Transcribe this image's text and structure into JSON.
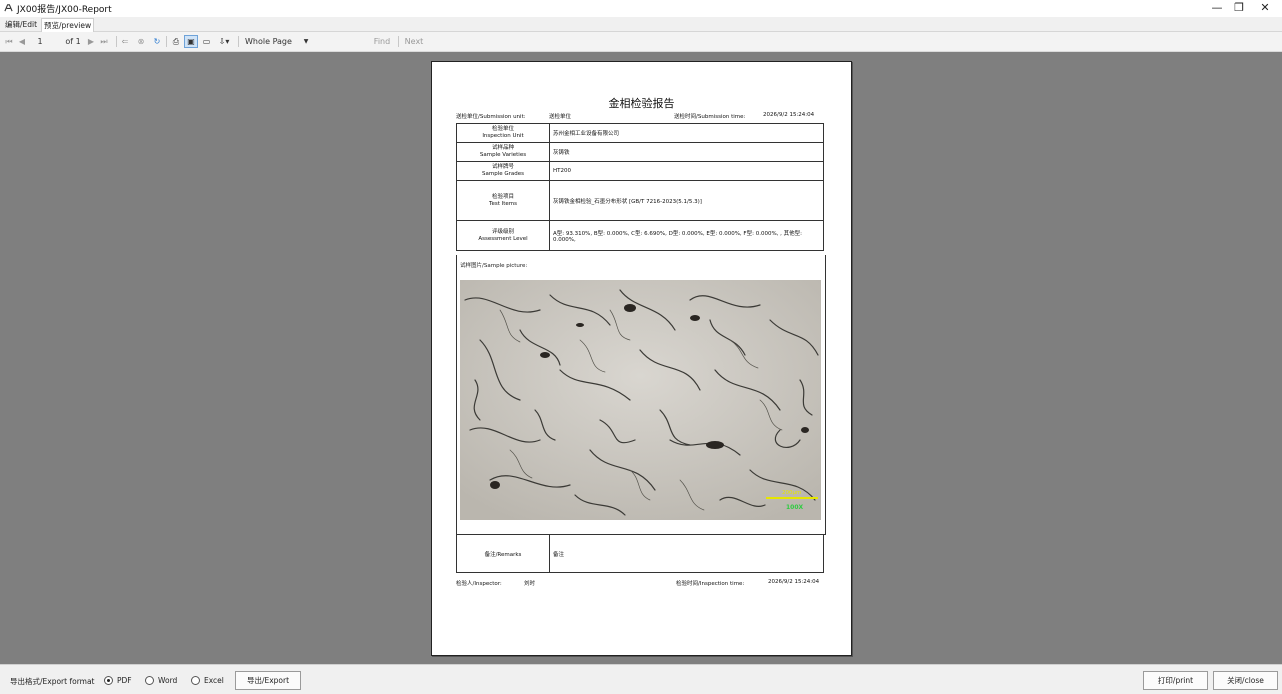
{
  "window": {
    "title": "JX00报告/JX00-Report",
    "minimize_glyph": "—",
    "restore_glyph": "❐",
    "close_glyph": "✕"
  },
  "tabs": [
    {
      "label": "编辑/Edit"
    },
    {
      "label": "预览/preview",
      "active": true
    }
  ],
  "toolbar": {
    "page_number": "1",
    "page_of": "of 1",
    "zoom_mode": "Whole Page",
    "search_value": "",
    "find_label": "Find",
    "next_label": "Next"
  },
  "report": {
    "title": "金相检验报告",
    "submission_unit_label": "送检单位/Submission unit:",
    "submission_unit_value": "送检单位",
    "submission_time_label": "送检时间/Submission time:",
    "submission_time_value": "2026/9/2 15:24:04",
    "rows": [
      {
        "label_cn": "检验单位",
        "label_en": "Inspection Unit",
        "value": "苏州金相工业设备有限公司"
      },
      {
        "label_cn": "试样品种",
        "label_en": "Sample Varieties",
        "value": "灰铸铁"
      },
      {
        "label_cn": "试样牌号",
        "label_en": "Sample Grades",
        "value": "HT200"
      },
      {
        "label_cn": "检验项目",
        "label_en": "Test Items",
        "value": "灰铸铁金相检验_石墨分布形状 [GB/T 7216-2023(5.1/5.3)]"
      },
      {
        "label_cn": "评级级别",
        "label_en": "Assessment Level",
        "value": "A型: 93.310%, B型: 0.000%, C型: 6.690%, D型: 0.000%, E型: 0.000%, F型: 0.000%, , 其他型: 0.000%,"
      }
    ],
    "sample_picture_label": "试样图片/Sample picture:",
    "scale_text": "200μm",
    "magnification_text": "100X",
    "remarks_label": "备注/Remarks",
    "remarks_value": "备注",
    "inspector_label": "检验人/Inspector:",
    "inspector_value": "刘时",
    "inspection_time_label": "检验时间/Inspection time:",
    "inspection_time_value": "2026/9/2 15:24:04"
  },
  "bottom": {
    "export_format_label": "导出格式/Export format",
    "options": [
      "PDF",
      "Word",
      "Excel"
    ],
    "selected": "PDF",
    "export_button": "导出/Export",
    "print_button": "打印/print",
    "close_button": "关闭/close"
  },
  "colors": {
    "viewport_bg": "#7f7f7f",
    "scale_bar": "#e6e600",
    "magnification_text": "#2ecc40"
  }
}
